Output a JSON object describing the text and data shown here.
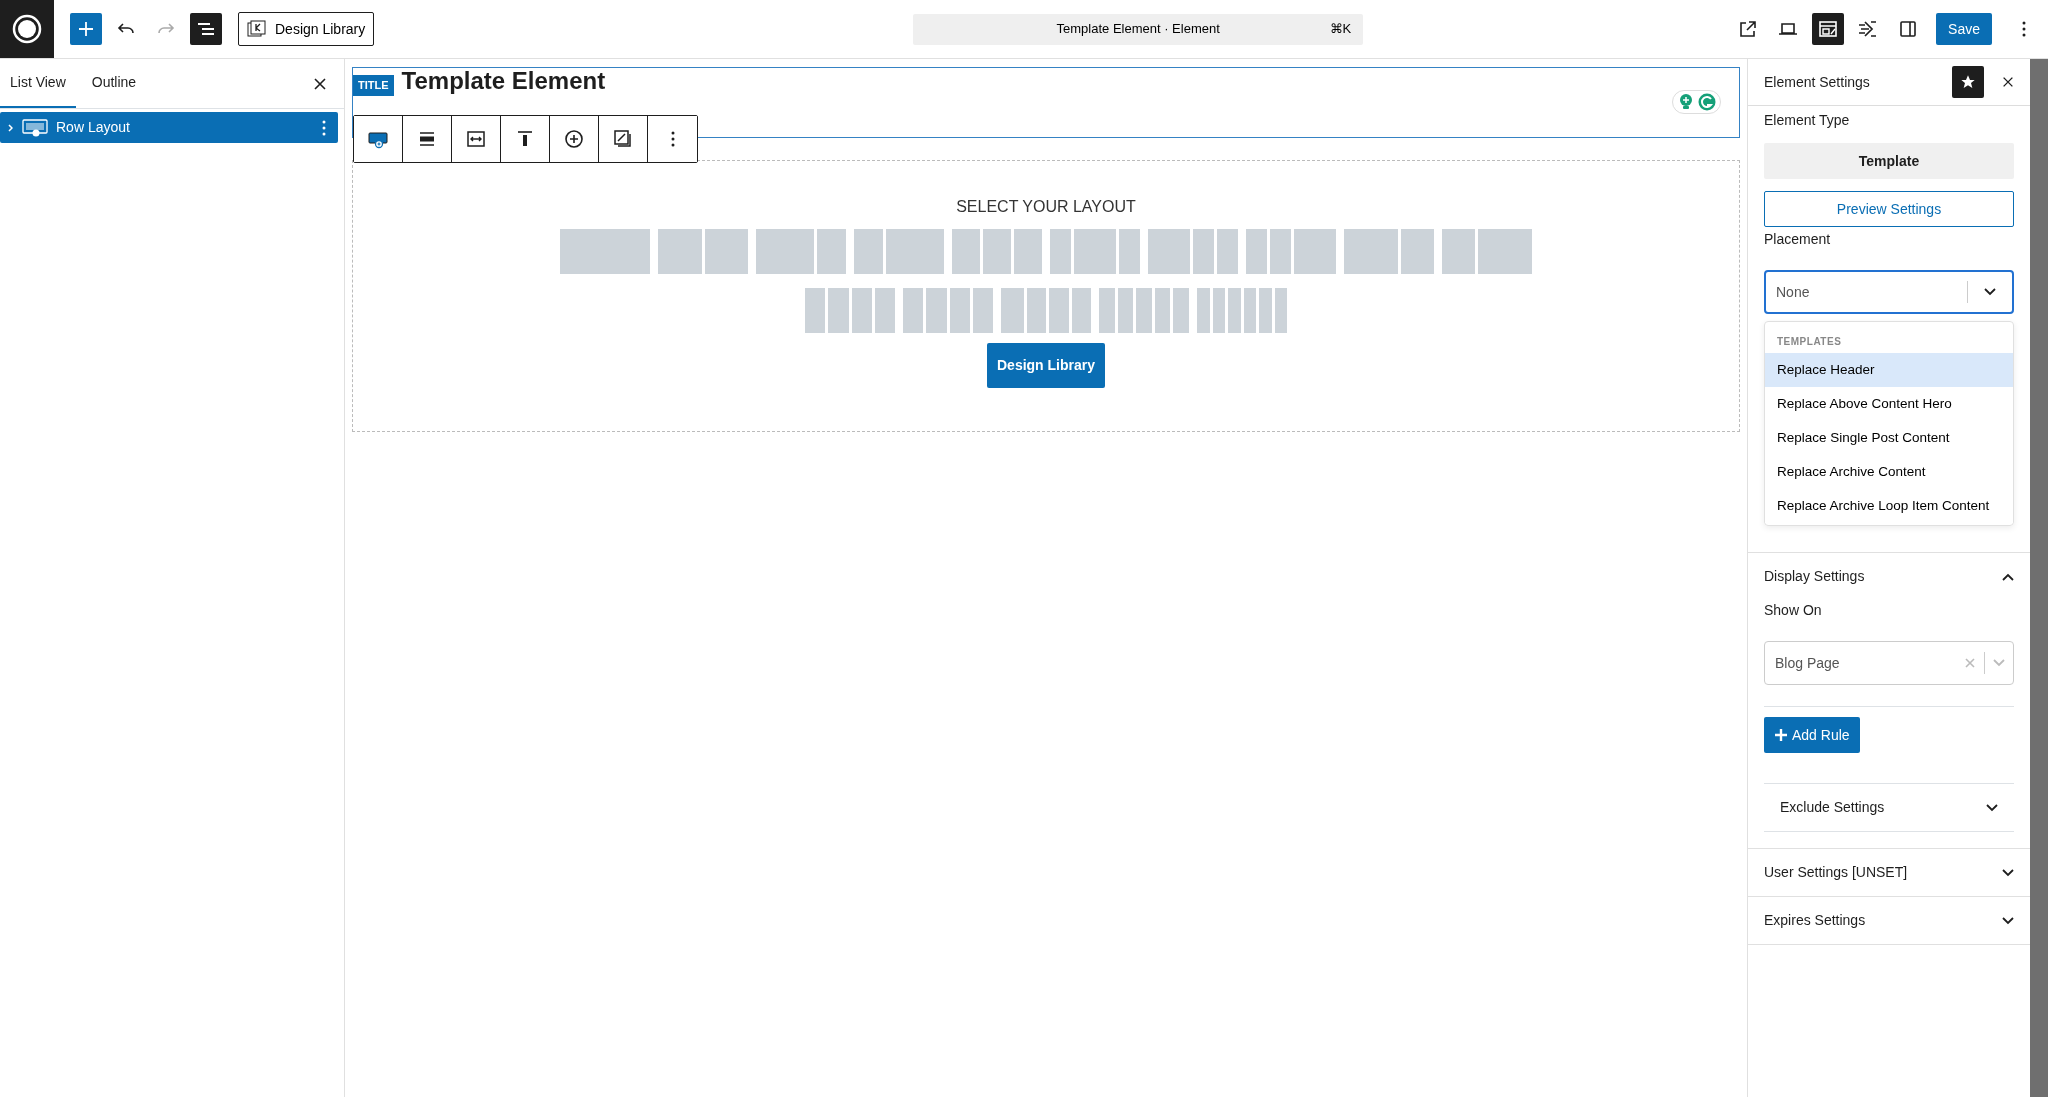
{
  "top_bar": {
    "left_buttons": [
      {
        "kind": "add",
        "selected": true,
        "disabled": false
      },
      {
        "kind": "undo",
        "selected": false,
        "disabled": false
      },
      {
        "kind": "redo",
        "selected": false,
        "disabled": true
      },
      {
        "kind": "list",
        "selected": true,
        "disabled": false
      }
    ],
    "library_button": "Design Library",
    "command_bar": {
      "title": "Template Element · Element",
      "shortcut": "⌘K"
    },
    "right_buttons": [
      {
        "kind": "external",
        "selected": false
      },
      {
        "kind": "laptop",
        "selected": false
      },
      {
        "kind": "panel",
        "selected": true
      },
      {
        "kind": "speed",
        "selected": false
      },
      {
        "kind": "sidebar",
        "selected": false
      }
    ],
    "save_button": "Save"
  },
  "left_panel": {
    "tabs": [
      {
        "label": "List View",
        "selected": true
      },
      {
        "label": "Outline",
        "selected": false
      }
    ],
    "items": [
      {
        "label": "Row Layout",
        "selected": true,
        "expanded": false
      }
    ]
  },
  "canvas": {
    "badge": "TITLE",
    "heading": "Template Element",
    "block_toolbar": [
      {
        "kind": "row"
      },
      {
        "kind": "align"
      },
      {
        "kind": "width"
      },
      {
        "kind": "valign"
      },
      {
        "kind": "add"
      },
      {
        "kind": "style"
      },
      {
        "kind": "more"
      }
    ],
    "layout_prompt": "SELECT YOUR LAYOUT",
    "layout_button": "Design Library"
  },
  "settings": {
    "title": "Element Settings",
    "element_type_label": "Element Type",
    "element_type": "Template",
    "preview_button": "Preview Settings",
    "placement_label": "Placement",
    "placement": {
      "value": "None",
      "open": true
    },
    "dropdown": {
      "group": "TEMPLATES",
      "options": [
        {
          "label": "Replace Header",
          "selected": true
        },
        {
          "label": "Replace Above Content Hero",
          "selected": false
        },
        {
          "label": "Replace Single Post Content",
          "selected": false
        },
        {
          "label": "Replace Archive Content",
          "selected": false
        },
        {
          "label": "Replace Archive Loop Item Content",
          "selected": false
        }
      ]
    },
    "display": {
      "title": "Display Settings",
      "expanded": true,
      "show_on_label": "Show On",
      "show_on": "Blog Page",
      "add_rule": "Add Rule",
      "exclude": {
        "title": "Exclude Settings",
        "expanded": false
      }
    },
    "sections": [
      {
        "title": "User Settings [UNSET]",
        "expanded": false
      },
      {
        "title": "Expires Settings",
        "expanded": false
      }
    ]
  }
}
